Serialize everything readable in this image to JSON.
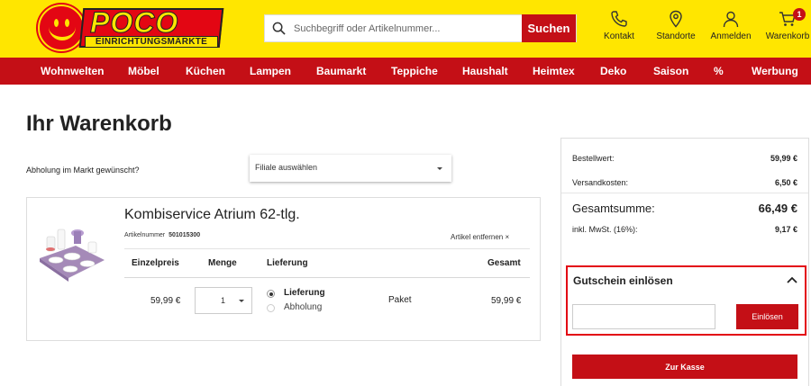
{
  "header": {
    "logo_text": "POCO",
    "logo_subtext": "EINRICHTUNGSMÄRKTE",
    "search": {
      "placeholder": "Suchbegriff oder Artikelnummer...",
      "button_label": "Suchen"
    },
    "icons": [
      {
        "id": "kontakt",
        "label": "Kontakt",
        "icon": "phone-icon"
      },
      {
        "id": "standorte",
        "label": "Standorte",
        "icon": "location-pin-icon"
      },
      {
        "id": "anmelden",
        "label": "Anmelden",
        "icon": "user-icon"
      },
      {
        "id": "warenkorb",
        "label": "Warenkorb",
        "icon": "cart-icon",
        "badge": "1"
      }
    ],
    "colors": {
      "yellow": "#ffe600",
      "red": "#c40f16"
    }
  },
  "nav": {
    "items": [
      "Wohnwelten",
      "Möbel",
      "Küchen",
      "Lampen",
      "Baumarkt",
      "Teppiche",
      "Haushalt",
      "Heimtex",
      "Deko",
      "Saison",
      "%",
      "Werbung"
    ]
  },
  "page": {
    "title": "Ihr Warenkorb",
    "pickup_label": "Abholung im Markt gewünscht?",
    "store_select_value": "Filiale auswählen"
  },
  "cart_item": {
    "name": "Kombiservice Atrium 62-tlg.",
    "article_label": "Artikelnummer",
    "article_number": "501015300",
    "remove_label": "Artikel entfernen ×",
    "headers": {
      "price": "Einzelpreis",
      "qty": "Menge",
      "delivery": "Lieferung",
      "total": "Gesamt"
    },
    "unit_price": "59,99 €",
    "quantity": "1",
    "delivery_options": [
      {
        "label": "Lieferung",
        "selected": true
      },
      {
        "label": "Abholung",
        "selected": false
      }
    ],
    "delivery_type": "Paket",
    "line_total": "59,99 €"
  },
  "summary": {
    "order_value_label": "Bestellwert:",
    "order_value": "59,99 €",
    "shipping_label": "Versandkosten:",
    "shipping": "6,50 €",
    "total_label": "Gesamtsumme:",
    "total": "66,49 €",
    "vat_label": "inkl. MwSt. (16%):",
    "vat": "9,17 €"
  },
  "voucher": {
    "title": "Gutschein einlösen",
    "input_placeholder": "",
    "button_label": "Einlösen"
  },
  "checkout": {
    "button_label": "Zur Kasse"
  }
}
